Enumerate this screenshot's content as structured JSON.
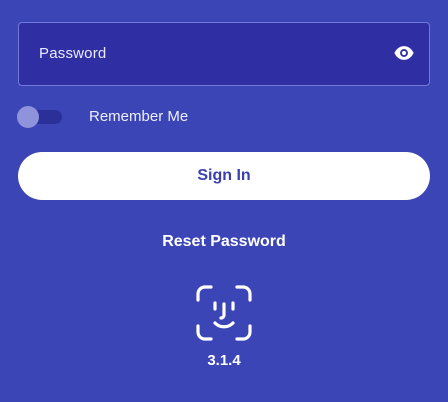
{
  "login": {
    "password_placeholder": "Password",
    "remember_me_label": "Remember Me",
    "remember_me_enabled": false,
    "sign_in_label": "Sign In",
    "reset_password_label": "Reset Password",
    "version": "3.1.4"
  },
  "icons": {
    "password_visibility": "eye-icon",
    "biometric": "face-id-icon"
  },
  "colors": {
    "background": "#3b45b5",
    "field_background": "#2f2fa3",
    "field_border": "#6f79d9",
    "button_background": "#ffffff",
    "button_text": "#3b3fb0",
    "toggle_knob": "#8f93db",
    "toggle_track": "#2a2f9a"
  }
}
